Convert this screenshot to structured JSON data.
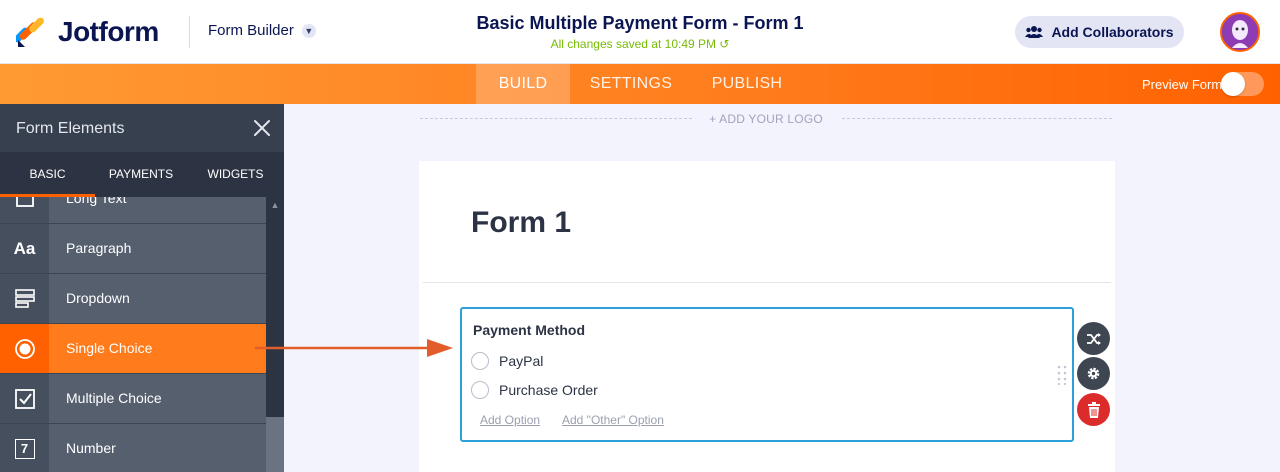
{
  "header": {
    "brand": "Jotform",
    "builder_menu": "Form Builder",
    "form_title": "Basic Multiple Payment Form - Form 1",
    "save_status": "All changes saved at 10:49 PM",
    "collaborators_button": "Add Collaborators"
  },
  "nav": {
    "tabs": [
      "BUILD",
      "SETTINGS",
      "PUBLISH"
    ],
    "active_tab": "BUILD",
    "preview_label": "Preview Form",
    "preview_enabled": false
  },
  "sidebar": {
    "title": "Form Elements",
    "tabs": [
      "BASIC",
      "PAYMENTS",
      "WIDGETS"
    ],
    "active_tab": "BASIC",
    "items": [
      {
        "label": "Long Text",
        "icon": "long-text-icon"
      },
      {
        "label": "Paragraph",
        "icon": "paragraph-icon",
        "glyph": "Aa"
      },
      {
        "label": "Dropdown",
        "icon": "dropdown-icon"
      },
      {
        "label": "Single Choice",
        "icon": "radio-icon",
        "active": true
      },
      {
        "label": "Multiple Choice",
        "icon": "checkbox-icon"
      },
      {
        "label": "Number",
        "icon": "number-icon",
        "glyph": "7"
      }
    ]
  },
  "canvas": {
    "add_logo": "+ ADD YOUR LOGO",
    "form_heading": "Form 1",
    "field": {
      "label": "Payment Method",
      "options": [
        "PayPal",
        "Purchase Order"
      ],
      "add_option": "Add Option",
      "add_other_option": "Add \"Other\" Option"
    }
  },
  "colors": {
    "brand_orange": "#ff6100",
    "brand_navy": "#0a1551",
    "save_green": "#78bb07",
    "field_border": "#2d9fd9",
    "delete_red": "#dc2b2b"
  }
}
